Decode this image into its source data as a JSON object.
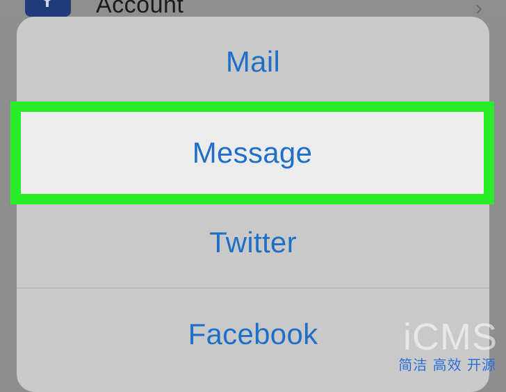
{
  "background_row": {
    "label": "Account",
    "icon": "key-icon",
    "chevron": "›"
  },
  "action_sheet": {
    "items": [
      {
        "label": "Mail"
      },
      {
        "label": "Message",
        "highlighted": true
      },
      {
        "label": "Twitter"
      },
      {
        "label": "Facebook"
      }
    ]
  },
  "highlight_color": "#2aed2a",
  "accent_color": "#1e6fc8",
  "watermark": {
    "logo": "iCMS",
    "tagline": "简洁 高效 开源"
  }
}
